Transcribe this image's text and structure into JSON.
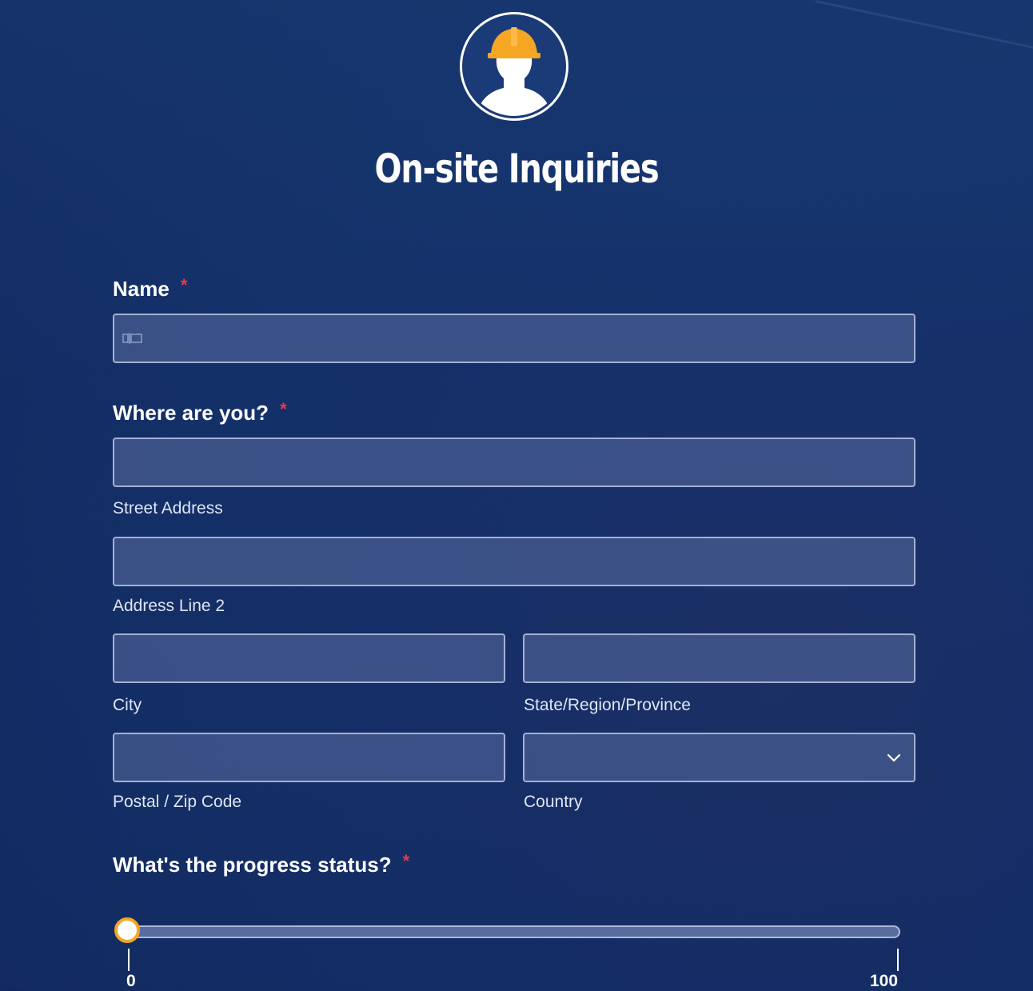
{
  "form": {
    "title": "On-site Inquiries",
    "logo_icon": "construction-worker-hardhat-icon",
    "accent_color": "#f5a623",
    "required_marker": "*",
    "required_color": "#e53b4b"
  },
  "name_field": {
    "label": "Name",
    "value": "",
    "icon": "contact-card-icon"
  },
  "address": {
    "label": "Where are you?",
    "street_label": "Street Address",
    "line2_label": "Address Line 2",
    "city_label": "City",
    "state_label": "State/Region/Province",
    "postal_label": "Postal / Zip Code",
    "country_label": "Country",
    "country_value": "",
    "country_icon": "chevron-down-icon"
  },
  "progress": {
    "label": "What's the progress status?",
    "min_label": "0",
    "max_label": "100",
    "value": 0
  }
}
